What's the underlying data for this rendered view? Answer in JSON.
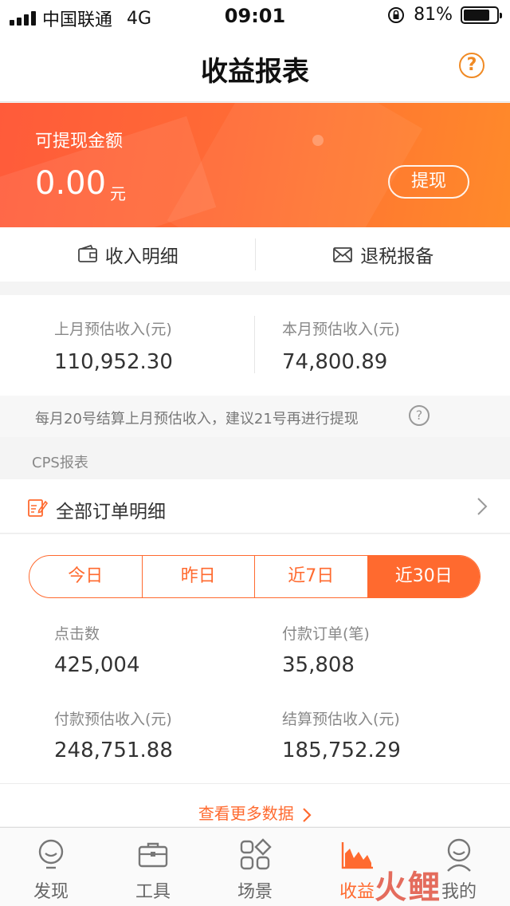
{
  "status_bar": {
    "carrier": "中国联通",
    "network": "4G",
    "time": "09:01",
    "battery_percent": "81%",
    "battery_level": 0.81
  },
  "nav": {
    "title": "收益报表",
    "help_symbol": "?"
  },
  "balance": {
    "label": "可提现金额",
    "amount": "0.00",
    "unit": "元",
    "withdraw_label": "提现"
  },
  "actions": [
    {
      "label": "收入明细",
      "icon": "wallet-icon"
    },
    {
      "label": "退税报备",
      "icon": "envelope-icon"
    }
  ],
  "month": {
    "last": {
      "label": "上月预估收入(元)",
      "value": "110,952.30"
    },
    "current": {
      "label": "本月预估收入(元)",
      "value": "74,800.89"
    }
  },
  "notice": {
    "text": "每月20号结算上月预估收入，建议21号再进行提现",
    "help_symbol": "?"
  },
  "cps": {
    "section_title": "CPS报表",
    "order_detail_label": "全部订单明细"
  },
  "periods": {
    "options": [
      "今日",
      "昨日",
      "近7日",
      "近30日"
    ],
    "selected": "近30日"
  },
  "stats": {
    "clicks": {
      "label": "点击数",
      "value": "425,004"
    },
    "paid_orders": {
      "label": "付款订单(笔)",
      "value": "35,808"
    },
    "paid_income": {
      "label": "付款预估收入(元)",
      "value": "248,751.88"
    },
    "settled_income": {
      "label": "结算预估收入(元)",
      "value": "185,752.29"
    }
  },
  "more_link": "查看更多数据",
  "tabs": [
    {
      "label": "发现",
      "icon": "bulb-icon"
    },
    {
      "label": "工具",
      "icon": "briefcase-icon"
    },
    {
      "label": "场景",
      "icon": "grid-icon"
    },
    {
      "label": "收益",
      "icon": "area-chart-icon"
    },
    {
      "label": "我的",
      "icon": "person-icon"
    }
  ],
  "active_tab": "收益",
  "watermark": "火鲤",
  "colors": {
    "accent": "#ff6a2f",
    "help_orange": "#f08a24",
    "banner_start": "#ff5b3a",
    "banner_end": "#ff8a2a"
  }
}
